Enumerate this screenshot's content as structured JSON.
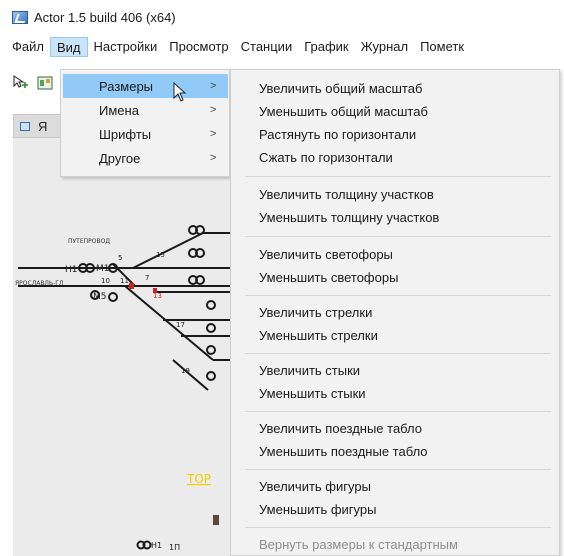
{
  "window": {
    "title": "Actor 1.5 build 406 (x64)"
  },
  "menubar": {
    "items": [
      "Файл",
      "Вид",
      "Настройки",
      "Просмотр",
      "Станции",
      "График",
      "Журнал",
      "Пометк"
    ]
  },
  "document_tab": {
    "label": "Я"
  },
  "view_menu": {
    "items": [
      {
        "label": "Размеры",
        "arrow": ">"
      },
      {
        "label": "Имена",
        "arrow": ">"
      },
      {
        "label": "Шрифты",
        "arrow": ">"
      },
      {
        "label": "Другое",
        "arrow": ">"
      }
    ]
  },
  "sizes_menu": {
    "items": [
      "Увеличить общий масштаб",
      "Уменьшить общий масштаб",
      "Растянуть по горизонтали",
      "Сжать по горизонтали",
      "Увеличить толщину участков",
      "Уменьшить толщину участков",
      "Увеличить светофоры",
      "Уменьшить светофоры",
      "Увеличить стрелки",
      "Уменьшить стрелки",
      "Увеличить стыки",
      "Уменьшить стыки",
      "Увеличить поездные табло",
      "Уменьшить поездные табло",
      "Увеличить фигуры",
      "Уменьшить фигуры",
      "Вернуть размеры к стандартным"
    ]
  },
  "diagram_labels": {
    "overpass": "ПУТЕПРОВОД",
    "yaroslavl": "ЯРОСЛАВЛЬ-ГЛ",
    "n1": "Н1",
    "m1": "М1",
    "m5": "М5",
    "num10": "10",
    "num11": "11",
    "num5": "5",
    "num7": "7",
    "num13": "13",
    "num15": "15",
    "num17": "17",
    "num19": "19",
    "yellow": "ТОР",
    "bottom_h1": "Н1",
    "bottom_1p": "1П"
  },
  "colors": {
    "menu_bg": "#f2f2f2",
    "highlight": "#91c9f7",
    "menubar_active": "#cce4f7",
    "disabled_text": "#8e8e8e",
    "workspace": "#ebebeb",
    "track_red": "#cc2222",
    "label_yellow": "#f0d000"
  }
}
